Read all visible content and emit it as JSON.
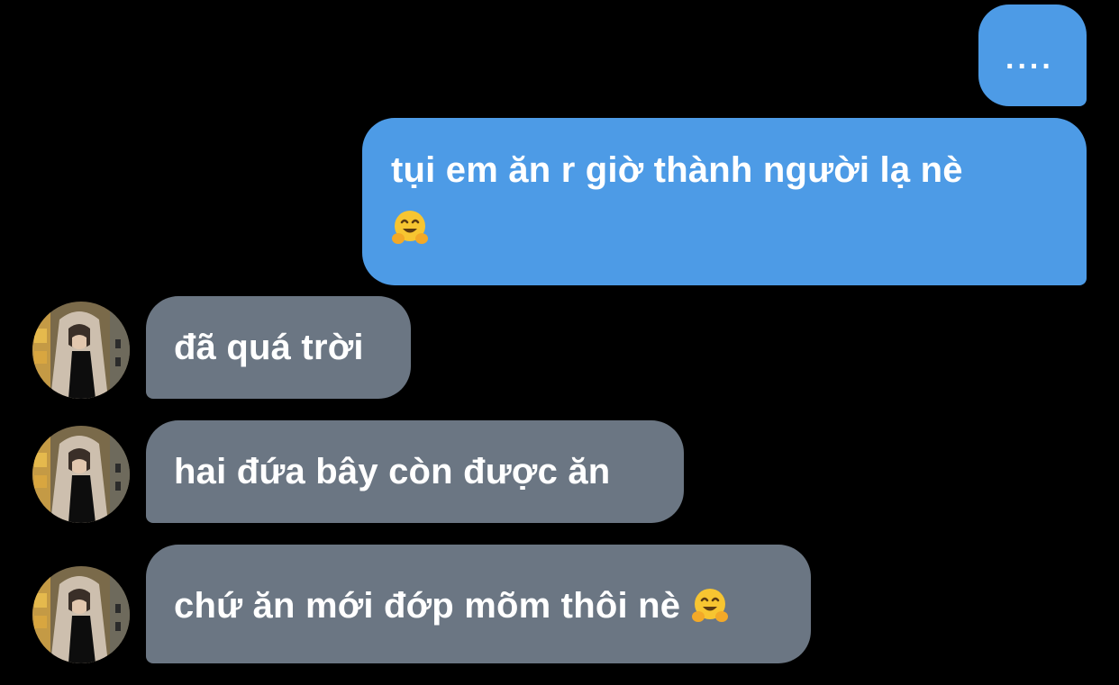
{
  "messages": [
    {
      "side": "sent",
      "text": "...."
    },
    {
      "side": "sent",
      "text": "tụi em ăn r giờ thành người lạ nè",
      "emoji": "hugging-face"
    },
    {
      "side": "received",
      "text": "đã quá trời"
    },
    {
      "side": "received",
      "text": "hai đứa bây còn được ăn"
    },
    {
      "side": "received",
      "text": "chứ ăn mới đớp mõm thôi nè",
      "emoji": "hugging-face"
    }
  ],
  "colors": {
    "background": "#000000",
    "sent_bubble": "#4d9be6",
    "received_bubble": "#6b7683",
    "text": "#ffffff"
  }
}
